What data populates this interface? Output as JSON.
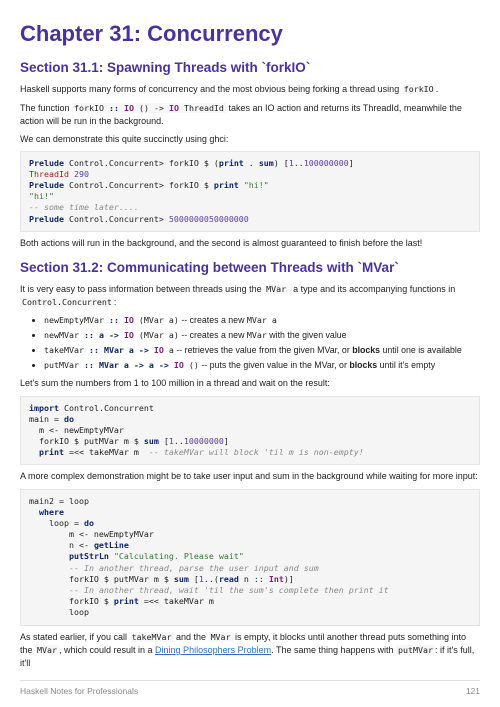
{
  "chapter": {
    "title": "Chapter 31: Concurrency"
  },
  "section1": {
    "title": "Section 31.1: Spawning Threads with `forkIO`",
    "p1_a": "Haskell supports many forms of concurrency and the most obvious being forking a thread using ",
    "p1_code": "forkIO",
    "p1_b": ".",
    "p2_a": "The function ",
    "p2_sig_name": "forkIO",
    "p2_sig_dcolon": " :: ",
    "p2_sig_io1": "IO",
    "p2_sig_unit": " () -> ",
    "p2_sig_io2": "IO",
    "p2_sig_tid": " ThreadId",
    "p2_b": " takes an IO action and returns its ThreadId, meanwhile the action will be run in the background.",
    "p3": "We can demonstrate this quite succinctly using ghci:",
    "code1_l1_prelude": "Prelude",
    "code1_l1_rest": " Control.Concurrent> forkIO $ (",
    "code1_l1_print": "print",
    "code1_l1_mid": " . ",
    "code1_l1_sum": "sum",
    "code1_l1_close": ") [",
    "code1_l1_n1": "1",
    "code1_l1_dots": "..",
    "code1_l1_n2": "100000000",
    "code1_l1_end": "]",
    "code1_l2_tid": "ThreadId",
    "code1_l2_num": " 290",
    "code1_l3_prelude": "Prelude",
    "code1_l3_rest": " Control.Concurrent> forkIO $ ",
    "code1_l3_print": "print",
    "code1_l3_sp": " ",
    "code1_l3_str": "\"hi!\"",
    "code1_l4": "\"hi!\"",
    "code1_l5": "-- some time later....",
    "code1_l6_prelude": "Prelude",
    "code1_l6_rest": " Control.Concurrent> ",
    "code1_l6_num": "5000000050000000",
    "p4": "Both actions will run in the background, and the second is almost guaranteed to finish before the last!"
  },
  "section2": {
    "title": "Section 31.2: Communicating between Threads with `MVar`",
    "p1_a": "It is very easy to pass information between threads using the ",
    "p1_c1": "MVar ",
    "p1_b": "a type and its accompanying functions in ",
    "p1_c2": "Control.Concurrent",
    "p1_c": ":",
    "bullets": {
      "b1_name": "newEmptyMVar",
      "b1_dcolon": " :: ",
      "b1_io": "IO",
      "b1_paren": " (MVar a)",
      "b1_desc_a": " -- creates a new ",
      "b1_desc_code": "MVar a",
      "b2_name": "newMVar",
      "b2_sig_a": " :: a -> ",
      "b2_io": "IO",
      "b2_paren": " (MVar a)",
      "b2_desc_a": " -- creates a new ",
      "b2_desc_code": "MVar",
      "b2_desc_b": " with the given value",
      "b3_name": "takeMVar",
      "b3_sig_a": " :: MVar a -> ",
      "b3_io": "IO",
      "b3_sig_b": " a",
      "b3_desc_a": " -- retrieves the value from the given MVar, or ",
      "b3_bold": "blocks",
      "b3_desc_b": " until one is available",
      "b4_name": "putMVar",
      "b4_sig_a": " :: MVar a -> a -> ",
      "b4_io": "IO",
      "b4_sig_b": " ()",
      "b4_desc_a": " -- puts the given value in the MVar, or ",
      "b4_bold": "blocks",
      "b4_desc_b": " until it's empty"
    },
    "p2": "Let's sum the numbers from 1 to 100 million in a thread and wait on the result:",
    "code2_l1_import": "import",
    "code2_l1_mod": " Control.Concurrent",
    "code2_l2_a": "main = ",
    "code2_l2_do": "do",
    "code2_l3": "  m <- newEmptyMVar",
    "code2_l4_a": "  forkIO $ putMVar m $ ",
    "code2_l4_sum": "sum",
    "code2_l4_b": " [",
    "code2_l4_n1": "1",
    "code2_l4_dots": "..",
    "code2_l4_n2": "10000000",
    "code2_l4_c": "]",
    "code2_l5_a": "  ",
    "code2_l5_print": "print",
    "code2_l5_b": " =<< takeMVar m  ",
    "code2_l5_cm": "-- takeMVar will block 'til m is non-empty!",
    "p3": "A more complex demonstration might be to take user input and sum in the background while waiting for more input:",
    "code3_l1": "main2 = loop",
    "code3_l2_sp": "  ",
    "code3_l2_where": "where",
    "code3_l3_a": "    loop = ",
    "code3_l3_do": "do",
    "code3_l4": "        m <- newEmptyMVar",
    "code3_l5_a": "        n <- ",
    "code3_l5_getline": "getLine",
    "code3_l6_a": "        ",
    "code3_l6_put": "putStrLn",
    "code3_l6_sp": " ",
    "code3_l6_str": "\"Calculating. Please wait\"",
    "code3_l7_sp": "        ",
    "code3_l7_cm": "-- In another thread, parse the user input and sum",
    "code3_l8_a": "        forkIO $ putMVar m $ ",
    "code3_l8_sum": "sum",
    "code3_l8_b": " [",
    "code3_l8_n1": "1",
    "code3_l8_c": "..(",
    "code3_l8_read": "read",
    "code3_l8_d": " n :: ",
    "code3_l8_int": "Int",
    "code3_l8_e": ")]",
    "code3_l9_sp": "        ",
    "code3_l9_cm": "-- In another thread, wait 'til the sum's complete then print it",
    "code3_l10_a": "        forkIO $ ",
    "code3_l10_print": "print",
    "code3_l10_b": " =<< takeMVar m",
    "code3_l11": "        loop",
    "p4_a": "As stated earlier, if you call ",
    "p4_c1": "takeMVar",
    "p4_b": " and the ",
    "p4_c2": "MVar",
    "p4_c": " is empty, it blocks until another thread puts something into the ",
    "p4_c3": "MVar",
    "p4_d": ", which could result in a ",
    "p4_link": "Dining Philosophers Problem",
    "p4_e": ". The same thing happens with ",
    "p4_c4": "putMVar",
    "p4_f": ": if it's full, it'll"
  },
  "footer": {
    "left": "Haskell Notes for Professionals",
    "right": "121"
  }
}
